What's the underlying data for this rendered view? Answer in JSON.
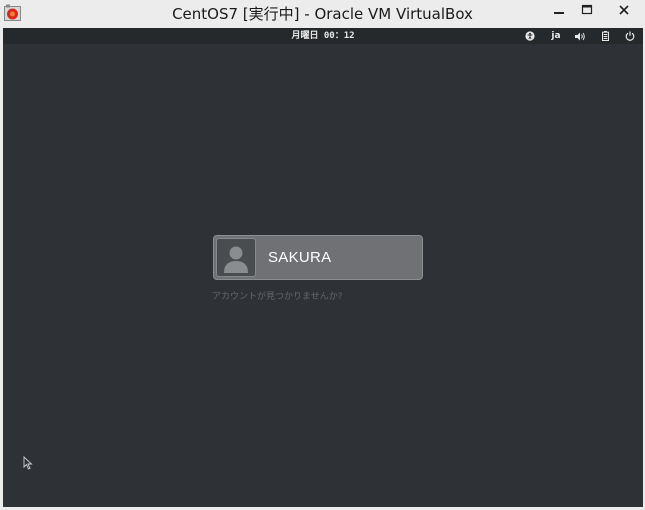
{
  "window": {
    "title": "CentOS7 [実行中] - Oracle VM VirtualBox",
    "app_icon": "virtualbox-icon",
    "controls": [
      "minimize-icon",
      "maximize-icon",
      "close-icon"
    ]
  },
  "topbar": {
    "clock": "月曜日 00：12",
    "tray": {
      "accessibility_icon": "accessibility-icon",
      "language": "ja",
      "volume_icon": "volume-icon",
      "battery_icon": "battery-icon",
      "power_icon": "power-icon"
    }
  },
  "login": {
    "user_name": "SAKURA",
    "avatar_icon": "user-avatar-icon",
    "not_listed_link": "アカウントが見つかりませんか?"
  },
  "colors": {
    "background": "#2e3236",
    "topbar": "#26292b",
    "user_card": "#6f7174",
    "link": "#62676b"
  }
}
